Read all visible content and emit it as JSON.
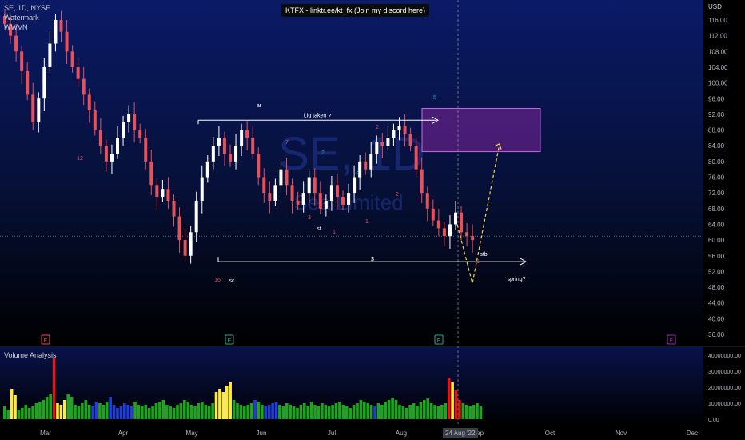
{
  "header": {
    "symbol_line": "SE, 1D, NYSE",
    "line2": "Watermark",
    "line3": "WWVN"
  },
  "banner": "KTFX - linktr.ee/kt_fx (Join my discord here)",
  "watermark": {
    "main": "SE, 1D",
    "sub": "Sea Limited"
  },
  "volume_panel": {
    "title": "Volume Analysis"
  },
  "crosshair_date": "24 Aug '22",
  "colors": {
    "up": "#ffffff",
    "down": "#e8505a",
    "vol_green": "#1ea51e",
    "vol_yellow": "#ffeb3b",
    "vol_red": "#e01515",
    "vol_blue": "#1f3fd6",
    "purple_box": "#9c27b0",
    "dashed_yellow": "#f2d64a"
  },
  "annotations": {
    "liq": "Liq taken ✓",
    "ar": "ar",
    "sc": "sc",
    "st": "st",
    "stb": "stb",
    "spring": "spring?",
    "dollar": "$",
    "n5": "5",
    "n12": "12",
    "n16": "16",
    "n7": "7",
    "n2a": "2",
    "n3a": "3",
    "n3b": "3",
    "n2b": "2",
    "n2c": "2",
    "n1a": "1",
    "n1b": "1",
    "n1c": "1"
  },
  "earnings_markers": [
    {
      "label": "E",
      "color": "#e8505a"
    },
    {
      "label": "E",
      "color": "#26a69a"
    },
    {
      "label": "E",
      "color": "#26a69a"
    },
    {
      "label": "E",
      "color": "#9c27b0"
    }
  ],
  "chart_data": [
    {
      "type": "candlestick",
      "title": "SE, 1D, NYSE",
      "x_axis": [
        "Mar",
        "Apr",
        "May",
        "Jun",
        "Jul",
        "Aug",
        "Sep",
        "Oct",
        "Nov",
        "Dec"
      ],
      "y_axis_unit": "USD",
      "y_ticks": [
        "116.00",
        "112.00",
        "108.00",
        "104.00",
        "100.00",
        "96.00",
        "92.00",
        "88.00",
        "84.00",
        "80.00",
        "76.00",
        "72.00",
        "68.00",
        "64.00",
        "60.00",
        "56.00",
        "52.00",
        "48.00",
        "44.00",
        "40.00",
        "36.00"
      ],
      "ylim": [
        33,
        120
      ],
      "price_line": 61.0,
      "liq_level": 90.5,
      "support_level": 54.5,
      "zone": {
        "from": 82.5,
        "to": 93.5
      },
      "projection": [
        49,
        84.5
      ],
      "closes": [
        115,
        112,
        108,
        103,
        97,
        90,
        96,
        104,
        110,
        116,
        113,
        108,
        104,
        101,
        97,
        93,
        88,
        84,
        80,
        82,
        86,
        90,
        92,
        88,
        86,
        80,
        74,
        71,
        73,
        70,
        66,
        60,
        56,
        62,
        70,
        76,
        80,
        84,
        86,
        82,
        80,
        84,
        88,
        86,
        82,
        76,
        72,
        70,
        74,
        78,
        74,
        70,
        69,
        72,
        76,
        72,
        68,
        70,
        74,
        71,
        69,
        72,
        76,
        80,
        78,
        82,
        85,
        84,
        86,
        88,
        89,
        87,
        84,
        78,
        72,
        68,
        65,
        63,
        61,
        64,
        67,
        62,
        61,
        60
      ]
    },
    {
      "type": "bar",
      "title": "Volume Analysis",
      "y_ticks": [
        "40000000.00",
        "30000000.00",
        "20000000.00",
        "10000000.00",
        "0.00"
      ],
      "ylim": [
        0,
        42000000
      ],
      "values": [
        8,
        6,
        19,
        15,
        6,
        7,
        9,
        7,
        8,
        10,
        11,
        12,
        14,
        16,
        38,
        10,
        9,
        12,
        16,
        14,
        9,
        8,
        10,
        12,
        9,
        8,
        11,
        10,
        9,
        11,
        14,
        9,
        7,
        8,
        10,
        9,
        8,
        11,
        9,
        8,
        9,
        7,
        8,
        10,
        11,
        12,
        9,
        8,
        7,
        9,
        10,
        12,
        11,
        9,
        8,
        10,
        11,
        9,
        8,
        10,
        17,
        19,
        17,
        21,
        23,
        12,
        10,
        9,
        8,
        9,
        10,
        12,
        11,
        9,
        8,
        9,
        10,
        11,
        9,
        8,
        10,
        9,
        8,
        7,
        9,
        10,
        8,
        11,
        9,
        8,
        10,
        9,
        8,
        9,
        10,
        11,
        9,
        8,
        7,
        9,
        10,
        12,
        11,
        10,
        9,
        8,
        10,
        9,
        11,
        12,
        13,
        12,
        9,
        8,
        7,
        9,
        10,
        8,
        11,
        12,
        13,
        10,
        9,
        8,
        9,
        10,
        26,
        23,
        18,
        12,
        10,
        9,
        8,
        9,
        10,
        8
      ],
      "bar_colors": "green|yellow|red|blue by volume analysis"
    }
  ]
}
